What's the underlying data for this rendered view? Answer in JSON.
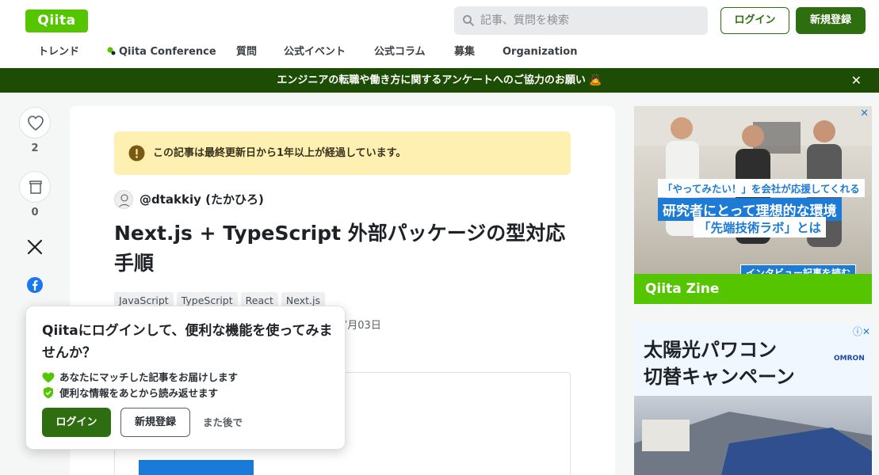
{
  "header": {
    "logo": "Qiita",
    "search_placeholder": "記事、質問を検索",
    "login_label": "ログイン",
    "signup_label": "新規登録"
  },
  "nav": {
    "items": [
      "トレンド",
      "Qiita Conference",
      "質問",
      "公式イベント",
      "公式コラム",
      "募集",
      "Organization"
    ]
  },
  "banner": {
    "text": "エンジニアの転職や働き方に関するアンケートへのご協力のお願い",
    "emoji": "🙇"
  },
  "rail": {
    "like_count": "2",
    "stock_count": "0"
  },
  "article": {
    "notice": "この記事は最終更新日から1年以上が経過しています。",
    "author": "@dtakkiy (たかひろ)",
    "title": "Next.js + TypeScript 外部パッケージの型対応手順",
    "tags": [
      "JavaScript",
      "TypeScript",
      "React",
      "Next.js"
    ],
    "date_fragment": "7月03日"
  },
  "popup": {
    "title": "Qiitaにログインして、便利な機能を使ってみませんか？",
    "benefit_1": "あなたにマッチした記事をお届けします",
    "benefit_2": "便利な情報をあとから読み返せます",
    "login_label": "ログイン",
    "signup_label": "新規登録",
    "later_label": "また後で"
  },
  "ads": {
    "ad1": {
      "caption_1": "「やってみたい！」を会社が応援してくれる",
      "caption_2": "研究者にとって理想的な環境",
      "caption_3": "「先端技術ラボ」とは",
      "cta": "インタビュー記事を読む",
      "brand": "Qiita Zine"
    },
    "ad2": {
      "line_1": "太陽光パワコン",
      "line_2": "切替キャンペーン",
      "brand": "OMRON"
    }
  },
  "colors": {
    "brand_green": "#55c500",
    "dark_green": "#2f6e10",
    "banner_green": "#1d4d05",
    "notice_yellow": "#fdf0b0"
  }
}
